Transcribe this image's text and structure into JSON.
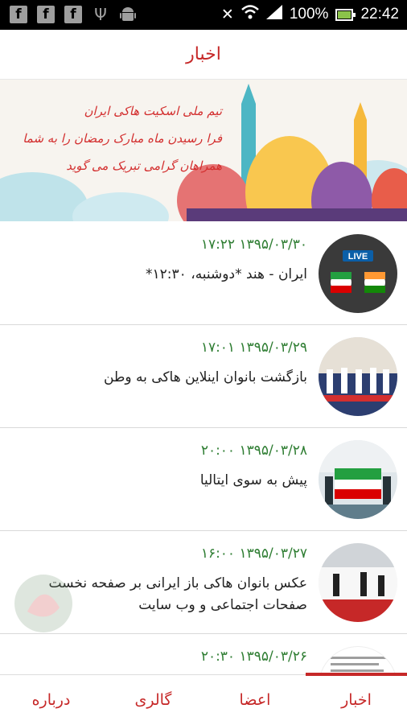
{
  "status_bar": {
    "left_icons": [
      "facebook-icon",
      "facebook-icon",
      "facebook-icon",
      "usb-icon",
      "android-icon"
    ],
    "battery": "100%",
    "battery_level": 1.0,
    "time": "22:42"
  },
  "header": {
    "title": "اخبار"
  },
  "banner": {
    "lines": [
      "تیم ملی اسکیت هاکی ایران",
      "فرا رسیدن ماه مبارک رمضان را به شما",
      "همراهان گرامی تبریک می گوید"
    ]
  },
  "news": [
    {
      "date": "۱۳۹۵/۰۳/۳۰ ۱۷:۲۲",
      "title": "ایران - هند *دوشنبه، ۱۲:۳۰*",
      "thumb": "live-match",
      "live_label": "LIVE"
    },
    {
      "date": "۱۳۹۵/۰۳/۲۹ ۱۷:۰۱",
      "title": "بازگشت بانوان اینلاین هاکی به وطن",
      "thumb": "team-photo"
    },
    {
      "date": "۱۳۹۵/۰۳/۲۸ ۲۰:۰۰",
      "title": "پیش به سوی ایتالیا",
      "thumb": "flag-ceremony"
    },
    {
      "date": "۱۳۹۵/۰۳/۲۷ ۱۶:۰۰",
      "title": "عکس  بانوان هاکی باز ایرانی بر صفحه نخست صفحات اجتماعی و وب سایت",
      "thumb": "rink-photo"
    },
    {
      "date": "۱۳۹۵/۰۳/۲۶ ۲۰:۳۰",
      "title": "",
      "thumb": "document"
    }
  ],
  "bottom_nav": {
    "tabs": [
      "اخبار",
      "اعضا",
      "گالری",
      "درباره"
    ],
    "active": "اخبار"
  },
  "colors": {
    "accent": "#c62828",
    "date_green": "#2e7d32"
  }
}
